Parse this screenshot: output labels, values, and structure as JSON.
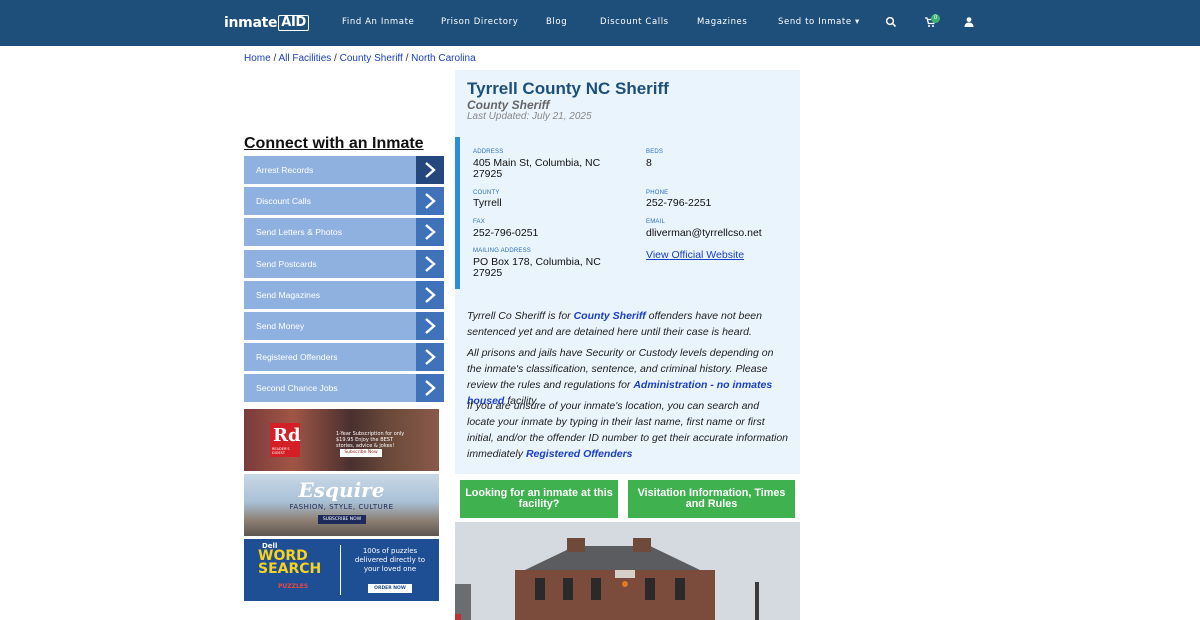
{
  "nav": {
    "logo_main": "inmate",
    "logo_box": "AID",
    "items": [
      "Find An Inmate",
      "Prison Directory",
      "Blog",
      "Discount Calls",
      "Magazines",
      "Send to Inmate"
    ],
    "cart_count": "0"
  },
  "breadcrumb": [
    "Home",
    "All Facilities",
    "County Sheriff",
    "North Carolina"
  ],
  "sidebar": {
    "title": "Connect with an Inmate",
    "items": [
      "Arrest Records",
      "Discount Calls",
      "Send Letters & Photos",
      "Send Postcards",
      "Send Magazines",
      "Send Money",
      "Registered Offenders",
      "Second Chance Jobs"
    ]
  },
  "ads": {
    "rd": {
      "logo": "Rd",
      "brand": "READER'S DIGEST",
      "text": "1-Year Subscription for only $19.95 Enjoy the BEST stories, advice & jokes!",
      "cta": "Subscribe Now"
    },
    "esquire": {
      "brand": "Esquire",
      "tagline": "FASHION, STYLE, CULTURE",
      "cta": "SUBSCRIBE NOW"
    },
    "wordsearch": {
      "brand_top": "Dell",
      "brand_main": "WORD SEARCH",
      "brand_sub": "PUZZLES",
      "text": "100s of puzzles delivered directly to your loved one",
      "cta": "ORDER NOW"
    }
  },
  "facility": {
    "name": "Tyrrell County NC Sheriff",
    "type": "County Sheriff",
    "updated": "Last Updated: July 21, 2025",
    "labels": {
      "address": "ADDRESS",
      "beds": "BEDS",
      "county": "COUNTY",
      "phone": "PHONE",
      "fax": "FAX",
      "email": "EMAIL",
      "mailing": "MAILING ADDRESS"
    },
    "address_1": "405 Main St, Columbia, NC",
    "address_2": "27925",
    "beds": "8",
    "county": "Tyrrell",
    "phone": "252-796-2251",
    "fax": "252-796-0251",
    "email": "dliverman@tyrrellcso.net",
    "mailing_1": "PO Box 178, Columbia, NC",
    "mailing_2": "27925",
    "website_link": "View Official Website"
  },
  "description": {
    "p1_a": "Tyrrell Co Sheriff is for ",
    "p1_link": "County Sheriff",
    "p1_b": " offenders have not been sentenced yet and are detained here until their case is heard.",
    "p2_a": "All prisons and jails have Security or Custody levels depending on the inmate's classification, sentence, and criminal history. Please review the rules and regulations for ",
    "p2_link": "Administration - no inmates housed",
    "p2_b": " facility.",
    "p3_a": "If you are unsure of your inmate's location, you can search and locate your inmate by typing in their last name, first name or first initial, and/or the offender ID number to get their accurate information immediately ",
    "p3_link": "Registered Offenders"
  },
  "buttons": {
    "looking": "Looking for an inmate at this facility?",
    "visitation": "Visitation Information, Times and Rules"
  },
  "colors": {
    "navbar": "#1d4f7a",
    "panel": "#eaf4fd",
    "accent": "#2a8fd8",
    "green": "#3fb24f",
    "side_item": "#8fb1e0"
  }
}
